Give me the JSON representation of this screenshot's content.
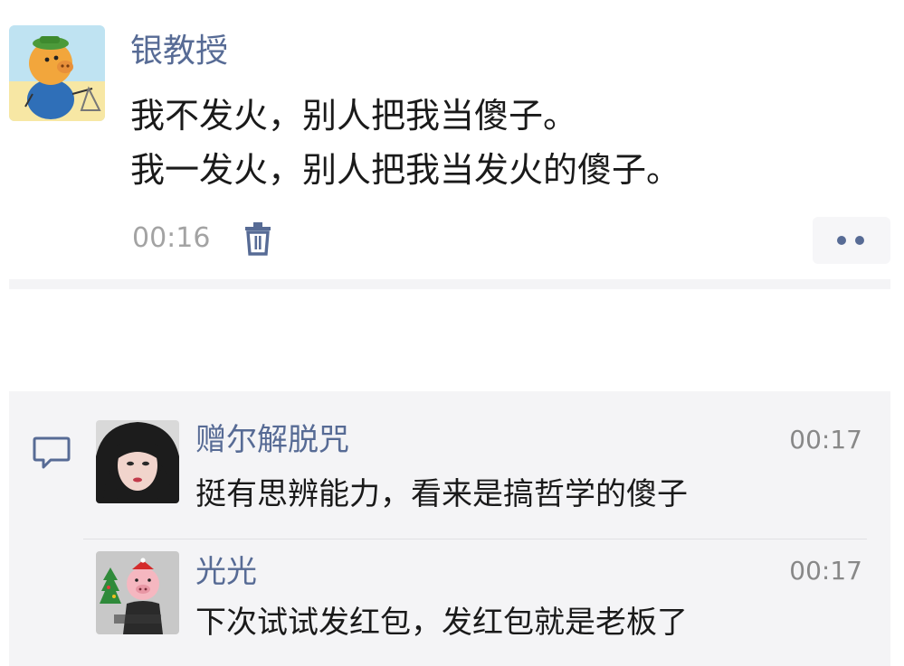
{
  "post": {
    "author": "银教授",
    "text_lines": [
      "我不发火，别人把我当傻子。",
      "我一发火，别人把我当发火的傻子。"
    ],
    "time": "00:16",
    "delete_icon": "trash-icon",
    "more_icon": "more-dots-icon"
  },
  "comments": [
    {
      "author": "赠尔解脱咒",
      "time": "00:17",
      "text": "挺有思辨能力，看来是搞哲学的傻子"
    },
    {
      "author": "光光",
      "time": "00:17",
      "text": "下次试试发红包，发红包就是老板了"
    }
  ],
  "comment_icon": "comment-bubble-icon",
  "colors": {
    "link": "#576b95",
    "text": "#1a1a1a",
    "muted": "#a3a3a3",
    "panel": "#f4f4f6"
  }
}
